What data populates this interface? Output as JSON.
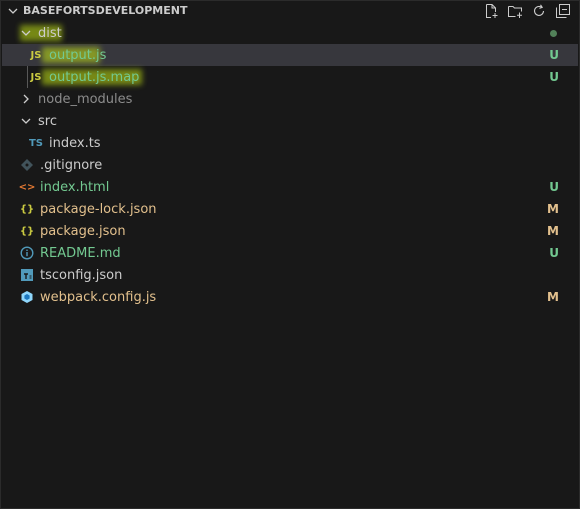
{
  "header": {
    "title": "BASEFORTSDEVELOPMENT",
    "actions": [
      {
        "name": "new-file-icon"
      },
      {
        "name": "new-folder-icon"
      },
      {
        "name": "refresh-icon"
      },
      {
        "name": "collapse-all-icon"
      }
    ]
  },
  "tree": {
    "dist": {
      "label": "dist"
    },
    "output_js": {
      "label": "output.js",
      "icon": "JS",
      "status": "U"
    },
    "output_map": {
      "label": "output.js.map",
      "icon": "JS",
      "status": "U"
    },
    "node_modules": {
      "label": "node_modules"
    },
    "src": {
      "label": "src"
    },
    "index_ts": {
      "label": "index.ts",
      "icon": "TS"
    },
    "gitignore": {
      "label": ".gitignore"
    },
    "index_html": {
      "label": "index.html",
      "icon": "<>",
      "status": "U"
    },
    "package_lock": {
      "label": "package-lock.json",
      "icon": "{}",
      "status": "M"
    },
    "package_json": {
      "label": "package.json",
      "icon": "{}",
      "status": "M"
    },
    "readme": {
      "label": "README.md",
      "status": "U"
    },
    "tsconfig": {
      "label": "tsconfig.json"
    },
    "webpack": {
      "label": "webpack.config.js",
      "status": "M"
    }
  },
  "colors": {
    "untracked": "#73c991",
    "modified": "#e2c08d",
    "js_icon": "#cbcb41",
    "ts_icon": "#519aba",
    "html_icon": "#e37933",
    "json_icon": "#cbcb41",
    "info_icon": "#519aba",
    "highlight": "#c5e614"
  }
}
